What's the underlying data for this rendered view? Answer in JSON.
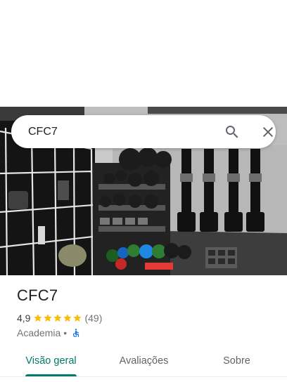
{
  "search": {
    "value": "CFC7",
    "placeholder": ""
  },
  "place": {
    "name": "CFC7",
    "rating": "4,9",
    "stars": 5,
    "review_count": "(49)",
    "category": "Academia",
    "separator": "•",
    "accessibility_icon": "wheelchair-accessible-icon"
  },
  "tabs": [
    {
      "label": "Visão geral",
      "active": true
    },
    {
      "label": "Avaliações",
      "active": false
    },
    {
      "label": "Sobre",
      "active": false
    }
  ],
  "colors": {
    "accent": "#00796b",
    "star": "#fbbc04",
    "accessibility": "#1a73e8"
  }
}
